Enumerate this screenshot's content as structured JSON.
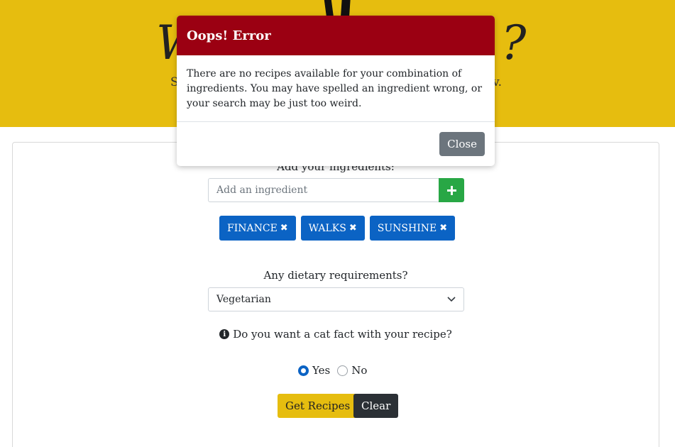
{
  "header": {
    "title_left": "W",
    "title_right": "?",
    "subtitle_left": "S",
    "subtitle_right": "v."
  },
  "form": {
    "ingredients_label": "Add your ingredients:",
    "ingredient_placeholder": "Add an ingredient",
    "add_icon": "plus-icon",
    "tags": [
      {
        "label": "FINANCE"
      },
      {
        "label": "WALKS"
      },
      {
        "label": "SUNSHINE"
      }
    ],
    "tag_remove_icon": "times-icon",
    "diet_label": "Any dietary requirements?",
    "diet_selected": "Vegetarian",
    "cat_question": "Do you want a cat fact with your recipe?",
    "radio_yes": "Yes",
    "radio_no": "No",
    "selected_radio": "Yes",
    "get_button": "Get Recipes",
    "clear_button": "Clear"
  },
  "modal": {
    "title": "Oops! Error",
    "body": "There are no recipes available for your combination of ingredients. You may have spelled an ingredient wrong, or your search may be just too weird.",
    "close_button": "Close"
  },
  "colors": {
    "header_bg": "#e6bd0f",
    "modal_header_bg": "#9b0012",
    "tag_bg": "#0b63c4",
    "add_button_bg": "#28a745",
    "clear_button_bg": "#2b3035",
    "close_button_bg": "#6c757d"
  }
}
